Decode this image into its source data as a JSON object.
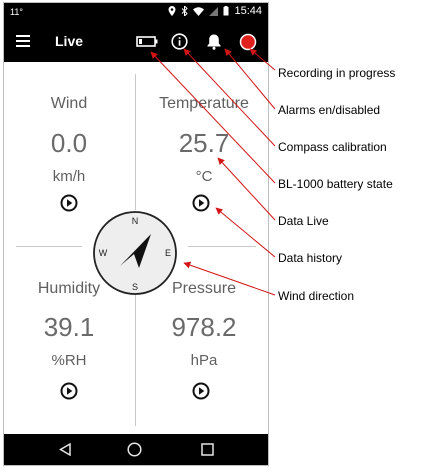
{
  "status_bar": {
    "left_text": "11°",
    "time": "15:44"
  },
  "app_bar": {
    "title": "Live",
    "icons": [
      "menu-icon",
      "battery-icon",
      "info-icon",
      "bell-icon",
      "record-icon"
    ]
  },
  "tiles": {
    "wind": {
      "label": "Wind",
      "value": "0.0",
      "unit": "km/h"
    },
    "temperature": {
      "label": "Temperature",
      "value": "25.7",
      "unit": "°C"
    },
    "humidity": {
      "label": "Humidity",
      "value": "39.1",
      "unit": "%RH"
    },
    "pressure": {
      "label": "Pressure",
      "value": "978.2",
      "unit": "hPa"
    }
  },
  "compass": {
    "north": "N",
    "east": "E",
    "south": "S",
    "west": "W"
  },
  "annotations": {
    "recording": "Recording in progress",
    "alarms": "Alarms en/disabled",
    "compass_calibration": "Compass calibration",
    "battery": "BL-1000 battery state",
    "data_live": "Data Live",
    "data_history": "Data history",
    "wind_direction": "Wind direction"
  },
  "colors": {
    "record": "#e0201c",
    "arrow": "#d21515",
    "bar": "#000000"
  }
}
